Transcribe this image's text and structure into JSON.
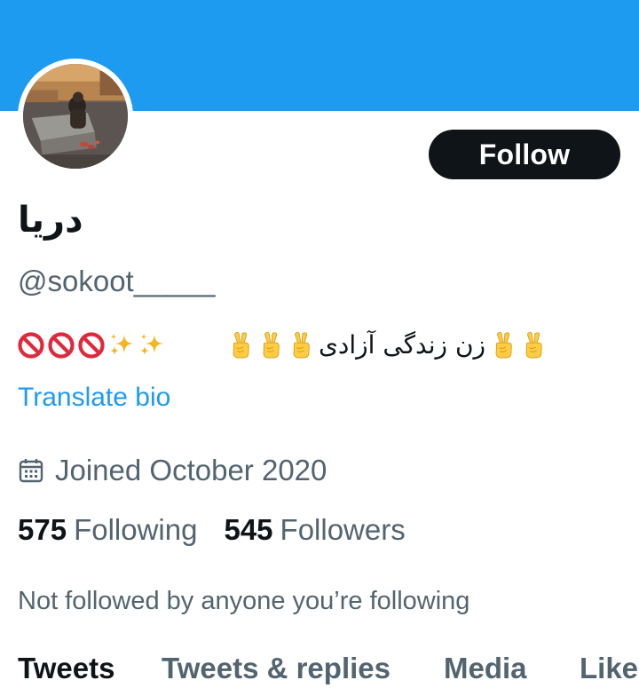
{
  "colors": {
    "banner": "#1d9bf0",
    "follow_button_bg": "#0f1419",
    "link": "#1d9bf0",
    "primary_text": "#0f1419",
    "secondary_text": "#536471"
  },
  "profile": {
    "display_name": "دریا",
    "handle": "@sokoot_____",
    "avatar_icon": "profile-photo-avatar",
    "follow_label": "Follow"
  },
  "bio": {
    "icons": [
      "prohibited-icon",
      "prohibited-icon",
      "prohibited-icon",
      "sparkles-icon",
      "sparkles-icon"
    ],
    "phrase": "زن زندگی آزادی",
    "phrase_icon": "victory-hand-icon",
    "translate_label": "Translate bio"
  },
  "meta": {
    "calendar_icon": "calendar-icon",
    "joined": "Joined October 2020"
  },
  "stats": {
    "following_count": "575",
    "following_label": "Following",
    "followers_count": "545",
    "followers_label": "Followers"
  },
  "social_context": "Not followed by anyone you’re following",
  "tabs": [
    {
      "label": "Tweets",
      "active": true
    },
    {
      "label": "Tweets & replies",
      "active": false
    },
    {
      "label": "Media",
      "active": false
    },
    {
      "label": "Likes",
      "active": false
    }
  ]
}
